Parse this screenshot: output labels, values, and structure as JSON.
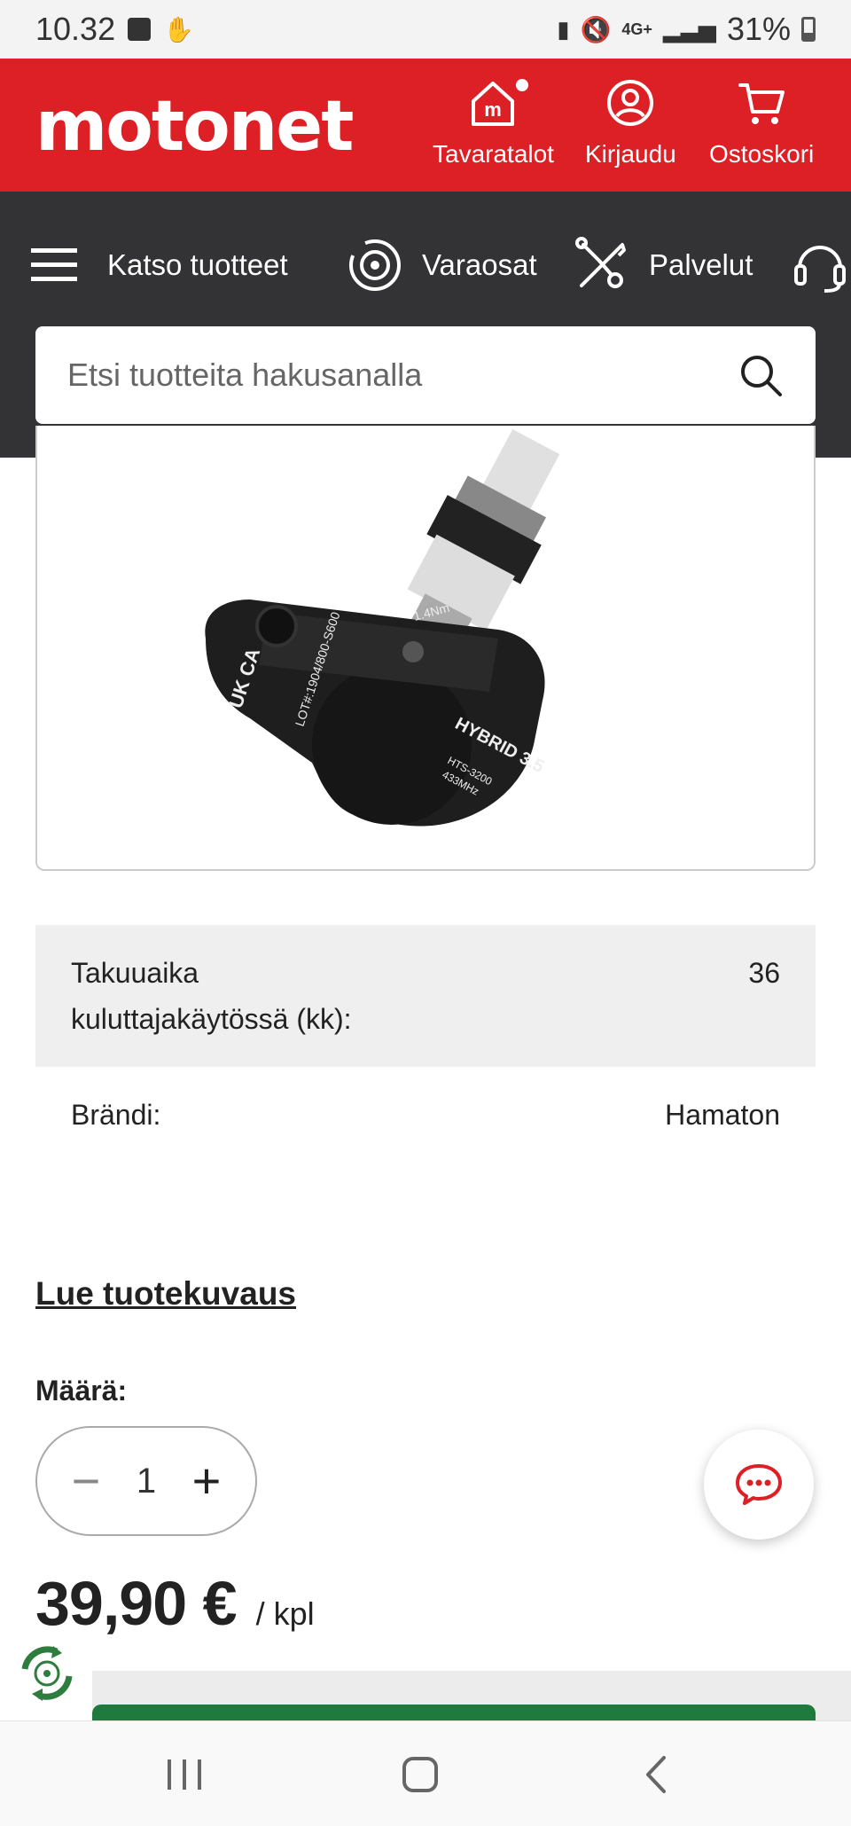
{
  "status_bar": {
    "time": "10.32",
    "network": "4G+",
    "battery": "31%"
  },
  "header": {
    "logo": "motonet",
    "stores_label": "Tavaratalot",
    "login_label": "Kirjaudu",
    "cart_label": "Ostoskori",
    "brand_color": "#dd1f26"
  },
  "nav": {
    "browse_label": "Katso tuotteet",
    "parts_label": "Varaosat",
    "services_label": "Palvelut",
    "search_placeholder": "Etsi tuotteita hakusanalla"
  },
  "product": {
    "image_texts": {
      "torque": "1.4Nm",
      "lot": "LOT#:1904/800-S600",
      "marks": "UK CA",
      "model": "HYBRID 3.5",
      "part": "HTS-3200",
      "freq": "433MHz"
    }
  },
  "specs": [
    {
      "label": "Takuuaika kuluttajakäytössä (kk):",
      "value": "36"
    },
    {
      "label": "Brändi:",
      "value": "Hamaton"
    }
  ],
  "read_description_label": "Lue tuotekuvaus",
  "quantity": {
    "label": "Määrä:",
    "value": "1"
  },
  "price": {
    "amount": "39,90 €",
    "unit": "/ kpl"
  },
  "icons": {
    "header": [
      "store-icon",
      "user-icon",
      "cart-icon"
    ],
    "nav": [
      "menu-icon",
      "brake-disc-icon",
      "tools-icon",
      "headset-icon"
    ],
    "other": [
      "search-icon",
      "chat-icon",
      "eco-icon"
    ]
  },
  "accent_color": "#1f7a3e"
}
